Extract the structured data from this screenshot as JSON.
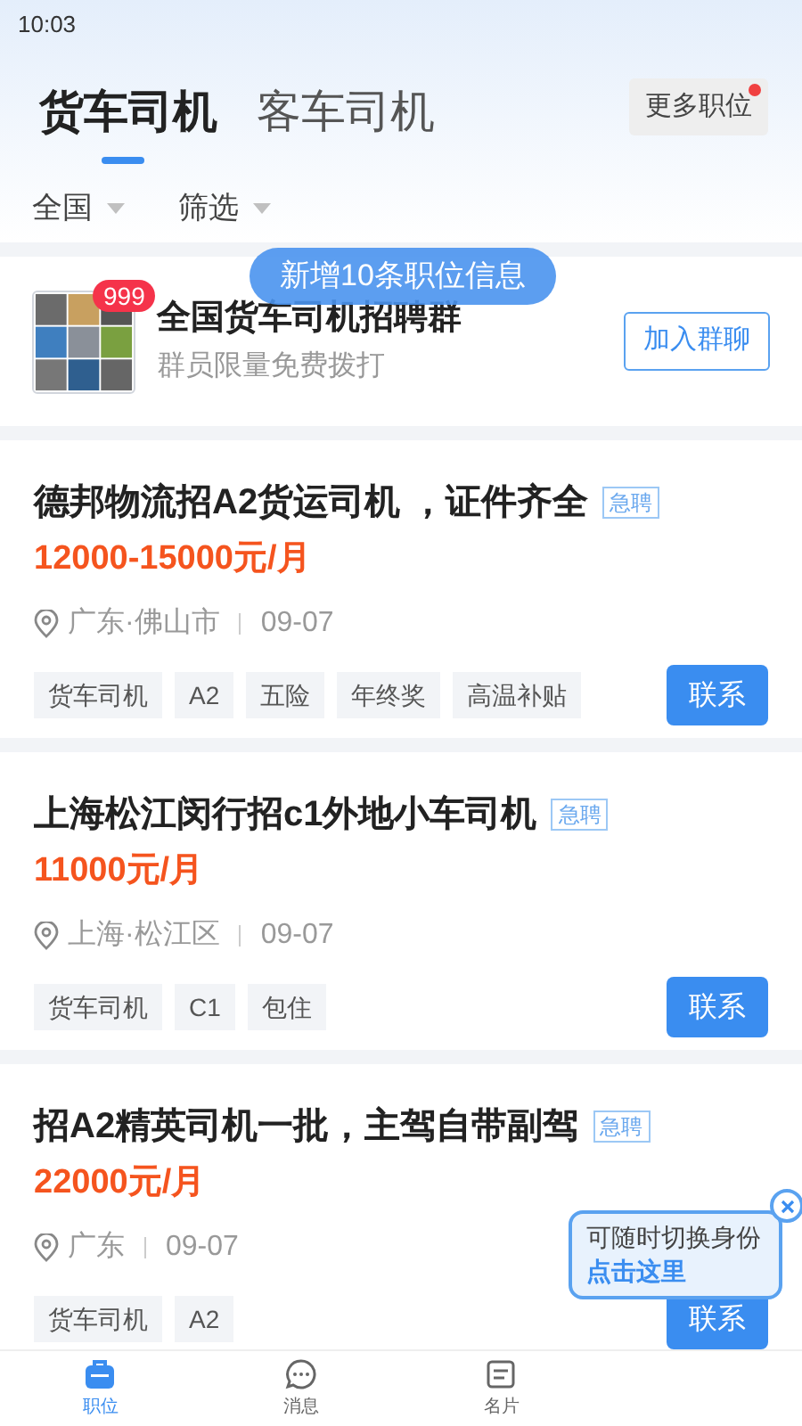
{
  "status_bar": {
    "time": "10:03"
  },
  "tabs": [
    {
      "label": "货车司机",
      "selected": true
    },
    {
      "label": "客车司机",
      "selected": false
    }
  ],
  "more_jobs": {
    "label": "更多职位",
    "has_dot": true
  },
  "filters": [
    {
      "label": "全国"
    },
    {
      "label": "筛选"
    }
  ],
  "group": {
    "badge": "999",
    "title": "全国货车司机招聘群",
    "subtitle": "群员限量免费拨打",
    "button": "加入群聊"
  },
  "toast": "新增10条职位信息",
  "jobs": [
    {
      "title": "德邦物流招A2货运司机 ，证件齐全",
      "urgent": "急聘",
      "salary": "12000-15000元/月",
      "location": "广东·佛山市",
      "date": "09-07",
      "tags": [
        "货车司机",
        "A2",
        "五险",
        "年终奖",
        "高温补贴"
      ],
      "button": "联系"
    },
    {
      "title": "上海松江闵行招c1外地小车司机",
      "urgent": "急聘",
      "salary": "11000元/月",
      "location": "上海·松江区",
      "date": "09-07",
      "tags": [
        "货车司机",
        "C1",
        "包住"
      ],
      "button": "联系"
    },
    {
      "title": "招A2精英司机一批，主驾自带副驾",
      "urgent": "急聘",
      "salary": "22000元/月",
      "location": "广东",
      "date": "09-07",
      "tags": [
        "货车司机",
        "A2"
      ],
      "button": "联系"
    }
  ],
  "tooltip": {
    "line1": "可随时切换身份",
    "line2": "点击这里"
  },
  "nav": [
    {
      "label": "职位",
      "kind": "briefcase",
      "selected": true
    },
    {
      "label": "消息",
      "kind": "chat",
      "selected": false
    },
    {
      "label": "名片",
      "kind": "card",
      "selected": false
    }
  ]
}
